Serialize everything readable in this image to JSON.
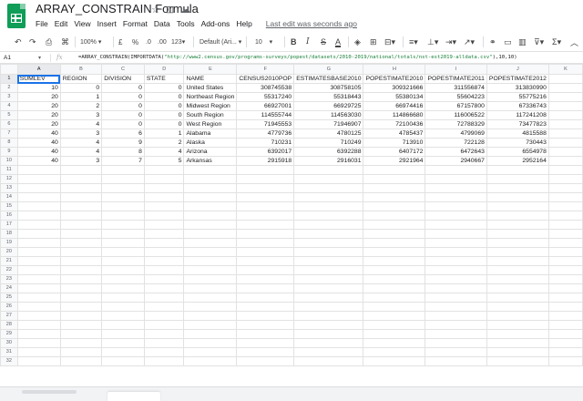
{
  "doc": {
    "title": "ARRAY_CONSTRAIN Formula",
    "last_edit": "Last edit was seconds ago"
  },
  "menu": [
    "File",
    "Edit",
    "View",
    "Insert",
    "Format",
    "Data",
    "Tools",
    "Add-ons",
    "Help"
  ],
  "toolbar": {
    "zoom": "100%",
    "currency": "£",
    "percent": "%",
    "dec_less": ".0",
    "dec_more": ".00",
    "more_formats": "123",
    "font": "Default (Ari...",
    "font_size": "10",
    "bold": "B",
    "italic": "I",
    "strike": "S",
    "text_color": "A"
  },
  "formula_bar": {
    "cell_ref": "A1",
    "fx": "fx",
    "formula_prefix": "=ARRAY_CONSTRAIN(IMPORTDATA(",
    "formula_string": "\"http://www2.census.gov/programs-surveys/popest/datasets/2010-2019/national/totals/nst-est2019-alldata.csv\"",
    "formula_suffix": "),10,10)"
  },
  "columns": [
    "A",
    "B",
    "C",
    "D",
    "E",
    "F",
    "G",
    "H",
    "I",
    "J",
    "K"
  ],
  "rows": [
    [
      "SUMLEV",
      "REGION",
      "DIVISION",
      "STATE",
      "NAME",
      "CENSUS2010POP",
      "ESTIMATESBASE2010",
      "POPESTIMATE2010",
      "POPESTIMATE2011",
      "POPESTIMATE2012",
      ""
    ],
    [
      "10",
      "0",
      "0",
      "0",
      "United States",
      "308745538",
      "308758105",
      "309321666",
      "311556874",
      "313830990",
      ""
    ],
    [
      "20",
      "1",
      "0",
      "0",
      "Northeast Region",
      "55317240",
      "55318443",
      "55380134",
      "55604223",
      "55775216",
      ""
    ],
    [
      "20",
      "2",
      "0",
      "0",
      "Midwest Region",
      "66927001",
      "66929725",
      "66974416",
      "67157800",
      "67336743",
      ""
    ],
    [
      "20",
      "3",
      "0",
      "0",
      "South Region",
      "114555744",
      "114563030",
      "114866680",
      "116006522",
      "117241208",
      ""
    ],
    [
      "20",
      "4",
      "0",
      "0",
      "West Region",
      "71945553",
      "71946907",
      "72100436",
      "72788329",
      "73477823",
      ""
    ],
    [
      "40",
      "3",
      "6",
      "1",
      "Alabama",
      "4779736",
      "4780125",
      "4785437",
      "4799069",
      "4815588",
      ""
    ],
    [
      "40",
      "4",
      "9",
      "2",
      "Alaska",
      "710231",
      "710249",
      "713910",
      "722128",
      "730443",
      ""
    ],
    [
      "40",
      "4",
      "8",
      "4",
      "Arizona",
      "6392017",
      "6392288",
      "6407172",
      "6472643",
      "6554978",
      ""
    ],
    [
      "40",
      "3",
      "7",
      "5",
      "Arkansas",
      "2915918",
      "2916031",
      "2921964",
      "2940667",
      "2952164",
      ""
    ]
  ],
  "empty_row_numbers": [
    "11",
    "12",
    "13",
    "14",
    "15",
    "16",
    "17",
    "18",
    "19",
    "20",
    "21",
    "22",
    "23",
    "24",
    "25",
    "26",
    "27",
    "28",
    "29",
    "30",
    "31",
    "32"
  ]
}
